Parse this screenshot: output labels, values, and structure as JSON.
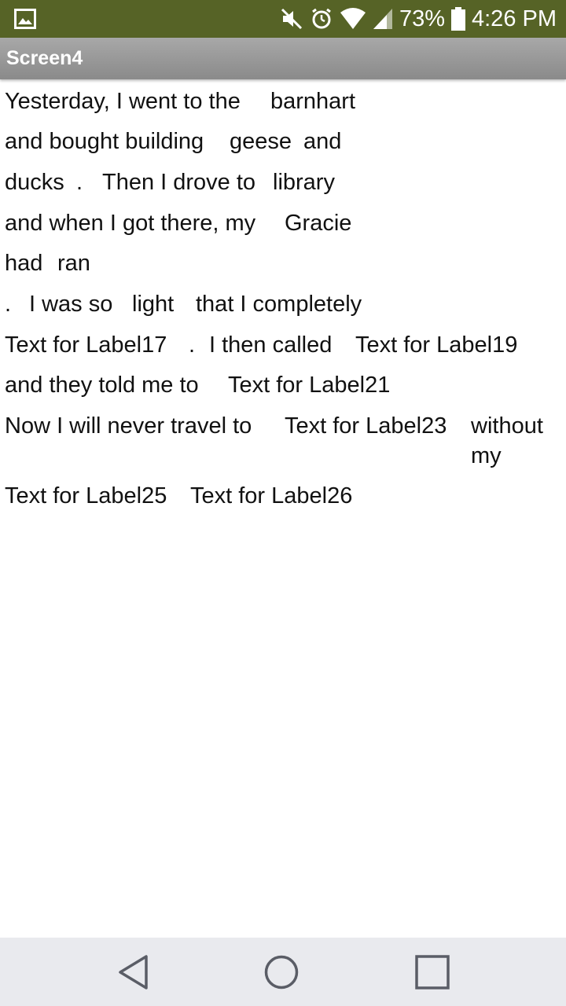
{
  "status_bar": {
    "battery_percent": "73%",
    "time": "4:26 PM",
    "icons": [
      "gallery-icon",
      "mute-icon",
      "alarm-icon",
      "wifi-icon",
      "signal-icon",
      "battery-icon"
    ],
    "background_color": "#566326"
  },
  "title_bar": {
    "title": "Screen4"
  },
  "story": {
    "line1": {
      "a": "Yesterday, I went to the",
      "b": "barnhart"
    },
    "line2": {
      "a": "and bought building",
      "b": "geese",
      "c": "and"
    },
    "line3": {
      "a": "ducks",
      "b": ".",
      "c": "Then I drove to",
      "d": "library"
    },
    "line4": {
      "a": "and when I got there, my",
      "b": "Gracie"
    },
    "line5": {
      "a": "had",
      "b": "ran"
    },
    "line6": {
      "a": ".",
      "b": "I was so",
      "c": "light",
      "d": "that I completely"
    },
    "line7": {
      "a": "Text for Label17",
      "b": ".",
      "c": "I then called",
      "d": "Text for Label19"
    },
    "line8": {
      "a": "and they told me to",
      "b": "Text for Label21"
    },
    "line9": {
      "a": "Now I will never travel to",
      "b": "Text for Label23",
      "c": "without",
      "d": "my"
    },
    "line10": {
      "a": "Text for Label25",
      "b": "Text for Label26"
    }
  },
  "nav_bar": {
    "buttons": [
      "back-icon",
      "home-icon",
      "recents-icon"
    ]
  }
}
